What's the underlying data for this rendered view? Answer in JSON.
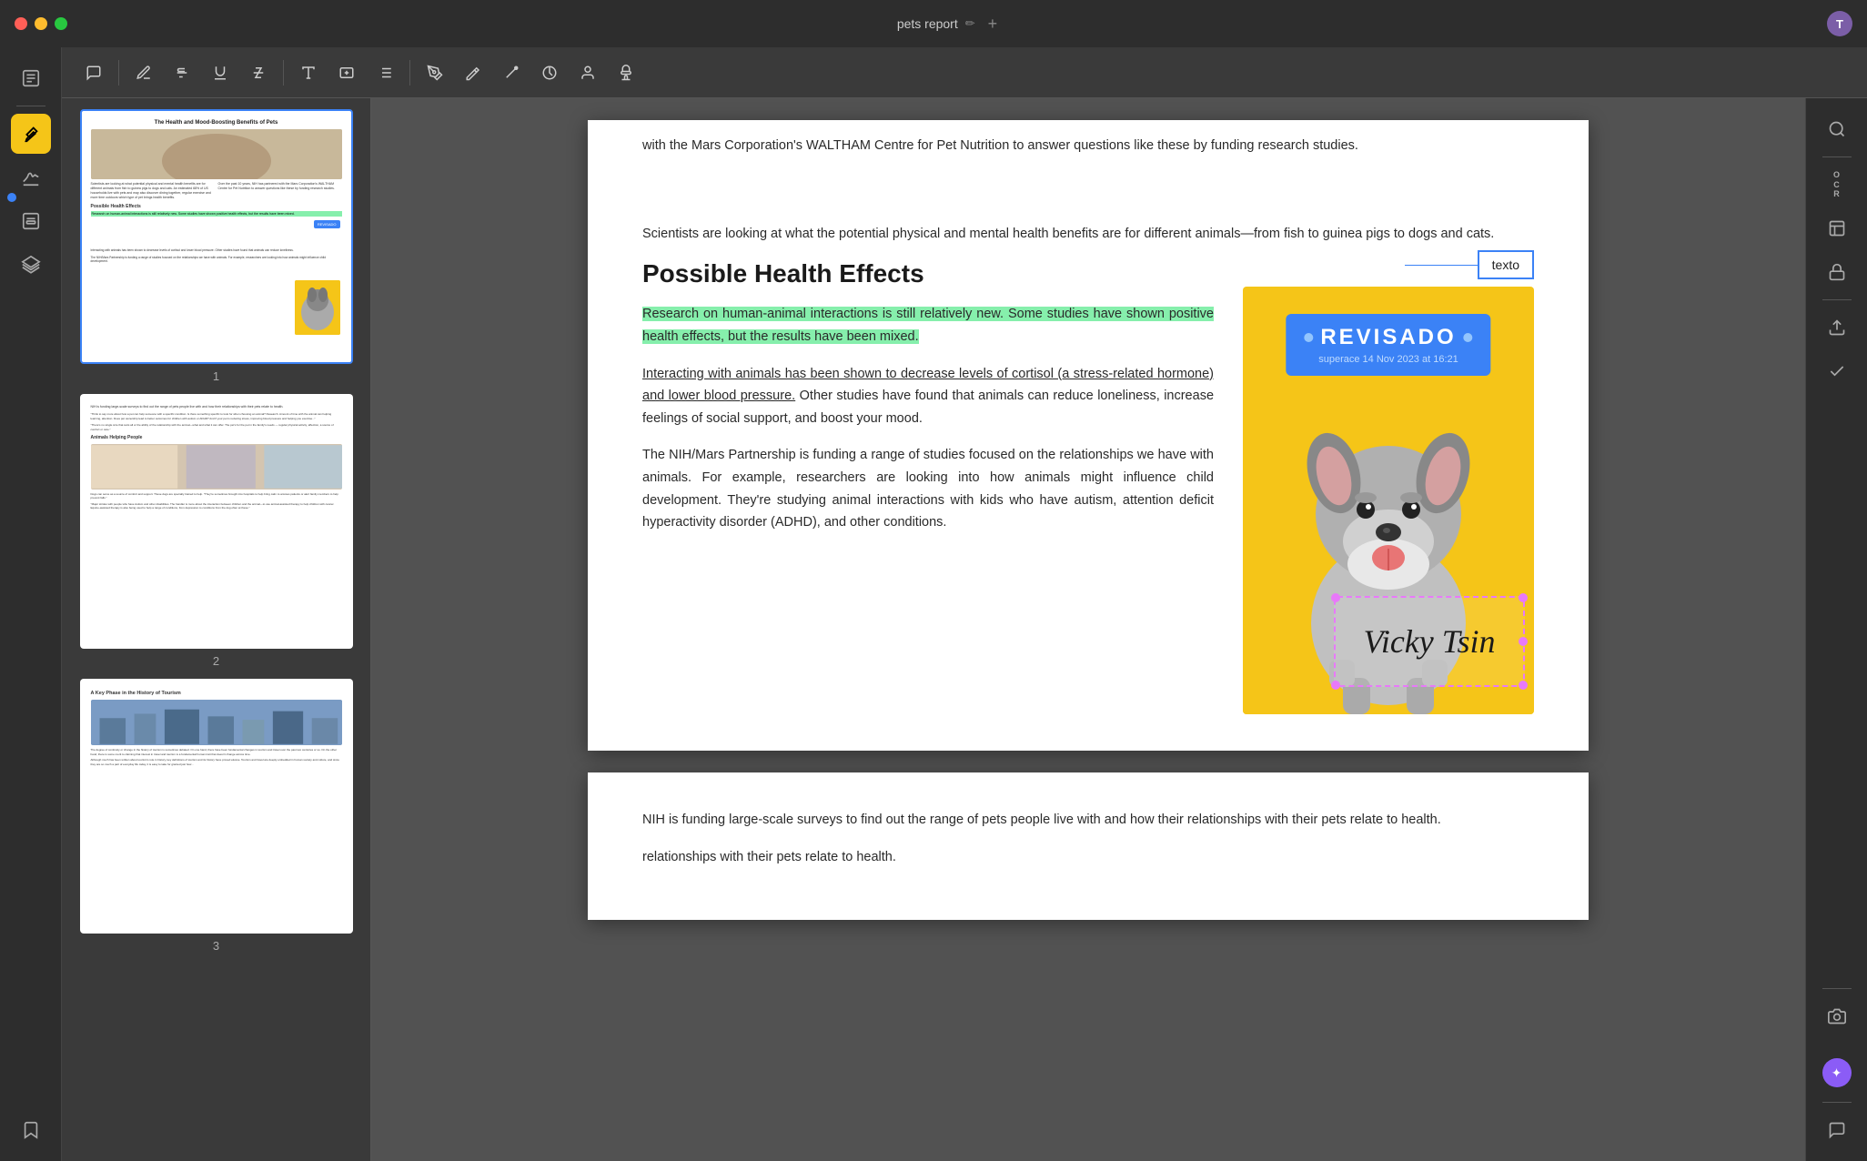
{
  "titlebar": {
    "title": "pets report",
    "close_label": "close",
    "minimize_label": "minimize",
    "maximize_label": "maximize",
    "avatar_initials": "T",
    "edit_icon": "✏️",
    "add_tab": "+"
  },
  "toolbar": {
    "tools": [
      {
        "name": "comment",
        "symbol": "💬",
        "active": false
      },
      {
        "name": "highlight",
        "symbol": "✏",
        "active": false
      },
      {
        "name": "strikethrough",
        "symbol": "S",
        "active": false
      },
      {
        "name": "underline",
        "symbol": "U",
        "active": false
      },
      {
        "name": "strikethrough2",
        "symbol": "T̶",
        "active": false
      },
      {
        "name": "text",
        "symbol": "T",
        "active": false
      },
      {
        "name": "textbox",
        "symbol": "⬜",
        "active": false
      },
      {
        "name": "list",
        "symbol": "☰",
        "active": false
      },
      {
        "name": "pen",
        "symbol": "✒",
        "active": false
      },
      {
        "name": "highlighter",
        "symbol": "🖊",
        "active": false
      },
      {
        "name": "line",
        "symbol": "╱",
        "active": false
      },
      {
        "name": "shape",
        "symbol": "○",
        "active": false
      },
      {
        "name": "person",
        "symbol": "👤",
        "active": false
      },
      {
        "name": "stamp",
        "symbol": "🖋",
        "active": false
      }
    ]
  },
  "left_sidebar": {
    "tools": [
      {
        "name": "document-list",
        "symbol": "📋",
        "active": false
      },
      {
        "name": "highlight-tool",
        "symbol": "✏",
        "active": true
      },
      {
        "name": "signature-tool",
        "symbol": "✍",
        "active": false
      },
      {
        "name": "form-tool",
        "symbol": "📝",
        "active": false
      },
      {
        "name": "layers-tool",
        "symbol": "◧",
        "active": false
      },
      {
        "name": "bookmark-tool",
        "symbol": "🔖",
        "active": false
      }
    ]
  },
  "right_sidebar": {
    "tools": [
      {
        "name": "search",
        "symbol": "🔍"
      },
      {
        "name": "ocr",
        "symbol": "OCR"
      },
      {
        "name": "scan",
        "symbol": "📷"
      },
      {
        "name": "lock",
        "symbol": "🔒"
      },
      {
        "name": "upload",
        "symbol": "⬆"
      },
      {
        "name": "checkmark",
        "symbol": "✓"
      },
      {
        "name": "chat",
        "symbol": "💬"
      },
      {
        "name": "snapshot",
        "symbol": "📷"
      }
    ]
  },
  "thumbnails": [
    {
      "page_num": "1",
      "title": "The Health and Mood-Boosting Benefits of Pets",
      "active": true
    },
    {
      "page_num": "2",
      "title": "Animals Helping People",
      "active": false
    },
    {
      "page_num": "3",
      "title": "A Key Phase in the History of Tourism",
      "active": false
    }
  ],
  "document": {
    "intro_text": "with the Mars Corporation's WALTHAM Centre for Pet Nutrition to answer questions like these by funding research studies.",
    "paragraph1": "Scientists are looking at what the potential physical and mental health benefits are for different animals—from fish to guinea pigs to dogs and cats.",
    "section_heading": "Possible Health Effects",
    "highlighted_paragraph": "Research on human-animal interactions is still relatively new. Some studies have shown positive health effects, but the results have been mixed.",
    "paragraph_animals": "Interacting with animals has been shown to decrease levels of cortisol (a stress-related hormone) and lower blood pressure. Other studies have found that animals can reduce loneliness, increase feelings of social support, and boost your mood.",
    "paragraph_nih": "The NIH/Mars Partnership is funding a range of studies focused on the relationships we have with animals. For example, researchers are looking into how animals might influence child development. They're studying animal interactions with kids who have autism, attention deficit hyperactivity disorder (ADHD), and other conditions.",
    "nih_section_text": "NIH is funding large-scale surveys to find out the range of pets people live with and how their relationships with their pets relate to health.",
    "stamp_label": "REVISADO",
    "stamp_subtitle": "superace 14 Nov 2023 at 16:21",
    "text_callout": "texto",
    "signature": "Vicky Tsin"
  }
}
